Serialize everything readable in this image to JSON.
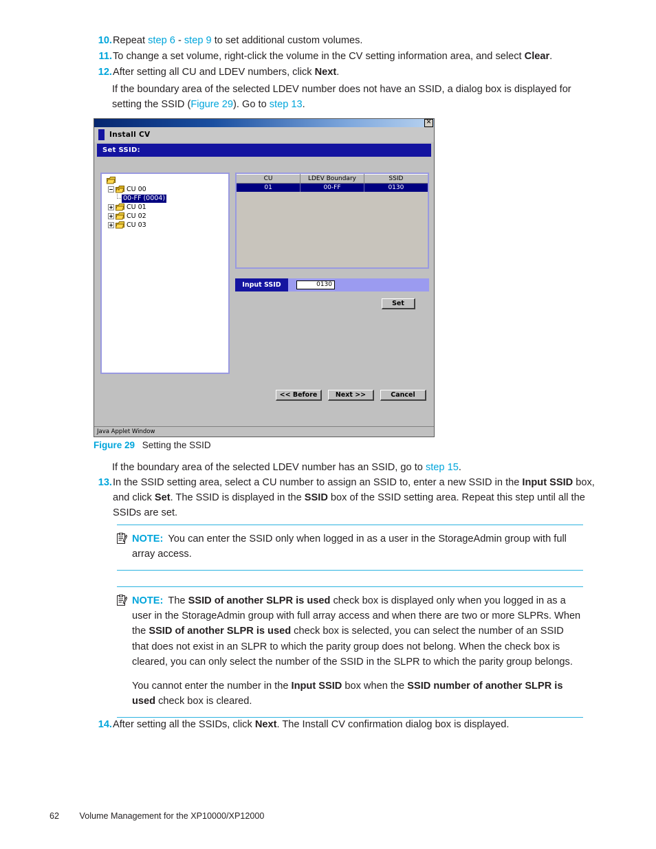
{
  "steps_top": [
    {
      "num": "10.",
      "parts": [
        {
          "t": "Repeat ",
          "s": "n"
        },
        {
          "t": "step 6",
          "s": "l"
        },
        {
          "t": " - ",
          "s": "n"
        },
        {
          "t": "step 9",
          "s": "l"
        },
        {
          "t": " to set additional custom volumes.",
          "s": "n"
        }
      ]
    },
    {
      "num": "11.",
      "parts": [
        {
          "t": "To change a set volume, right-click the volume in the CV setting information area, and select ",
          "s": "n"
        },
        {
          "t": "Clear",
          "s": "b"
        },
        {
          "t": ".",
          "s": "n"
        }
      ]
    },
    {
      "num": "12.",
      "parts": [
        {
          "t": "After setting all CU and LDEV numbers, click ",
          "s": "n"
        },
        {
          "t": "Next",
          "s": "b"
        },
        {
          "t": ".",
          "s": "n"
        }
      ]
    }
  ],
  "sub_para_12": [
    {
      "t": "If the boundary area of the selected LDEV number does not have an SSID, a dialog box is displayed for setting the SSID (",
      "s": "n"
    },
    {
      "t": "Figure 29",
      "s": "l"
    },
    {
      "t": "). Go to ",
      "s": "n"
    },
    {
      "t": "step 13",
      "s": "l"
    },
    {
      "t": ".",
      "s": "n"
    }
  ],
  "dialog": {
    "title": "Install CV",
    "close_icon": "close-icon",
    "section_label": "Set SSID:",
    "tree": {
      "root_icon": "root-folder-icon",
      "nodes": [
        {
          "label": "CU 00",
          "toggle": "minus",
          "indent": 1,
          "selected": false,
          "icon": "folder-open-icon"
        },
        {
          "label": "00-FF (0004)",
          "toggle": "none",
          "indent": 2,
          "selected": true,
          "icon": "none"
        },
        {
          "label": "CU 01",
          "toggle": "plus",
          "indent": 1,
          "selected": false,
          "icon": "folder-icon"
        },
        {
          "label": "CU 02",
          "toggle": "plus",
          "indent": 1,
          "selected": false,
          "icon": "folder-icon"
        },
        {
          "label": "CU 03",
          "toggle": "plus",
          "indent": 1,
          "selected": false,
          "icon": "folder-icon"
        }
      ]
    },
    "table": {
      "columns": [
        "CU",
        "LDEV Boundary",
        "SSID"
      ],
      "rows": [
        [
          "01",
          "00-FF",
          "0130"
        ]
      ]
    },
    "input_ssid": {
      "label": "Input SSID",
      "value": "0130"
    },
    "set_button": "Set",
    "footer_buttons": [
      "<< Before",
      "Next >>",
      "Cancel"
    ],
    "status_bar": "Java Applet Window"
  },
  "figure_caption": {
    "label": "Figure 29",
    "text": "Setting the SSID"
  },
  "para_after_figure": [
    {
      "t": "If the boundary area of the selected LDEV number has an SSID, go to ",
      "s": "n"
    },
    {
      "t": "step 15",
      "s": "l"
    },
    {
      "t": ".",
      "s": "n"
    }
  ],
  "step13": {
    "num": "13.",
    "parts": [
      {
        "t": "In the SSID setting area, select a CU number to assign an SSID to, enter a new SSID in the ",
        "s": "n"
      },
      {
        "t": "Input SSID",
        "s": "b"
      },
      {
        "t": " box, and click ",
        "s": "n"
      },
      {
        "t": "Set",
        "s": "b"
      },
      {
        "t": ". The SSID is displayed in the ",
        "s": "n"
      },
      {
        "t": "SSID",
        "s": "b"
      },
      {
        "t": " box of the SSID setting area. Repeat this step until all the SSIDs are set.",
        "s": "n"
      }
    ]
  },
  "note1": {
    "icon": "note-clipboard-icon",
    "word": "NOTE:",
    "parts": [
      {
        "t": "You can enter the SSID only when logged in as a user in the StorageAdmin group with full array access.",
        "s": "n"
      }
    ]
  },
  "note2": {
    "icon": "note-clipboard-icon",
    "word": "NOTE:",
    "parts": [
      {
        "t": "The ",
        "s": "n"
      },
      {
        "t": "SSID of another SLPR is used",
        "s": "b"
      },
      {
        "t": " check box is displayed only when you logged in as a user in the StorageAdmin group with full array access and when there are two or more SLPRs. When the ",
        "s": "n"
      },
      {
        "t": "SSID of another SLPR is used",
        "s": "b"
      },
      {
        "t": " check box is selected, you can select the number of an SSID that does not exist in an SLPR to which the parity group does not belong. When the check box is cleared, you can only select the number of the SSID in the SLPR to which the parity group belongs.",
        "s": "n"
      }
    ],
    "parts2": [
      {
        "t": "You cannot enter the number in the ",
        "s": "n"
      },
      {
        "t": "Input SSID",
        "s": "b"
      },
      {
        "t": " box when the ",
        "s": "n"
      },
      {
        "t": "SSID number of another SLPR is used",
        "s": "b"
      },
      {
        "t": " check box is cleared.",
        "s": "n"
      }
    ]
  },
  "step14": {
    "num": "14.",
    "parts": [
      {
        "t": "After setting all the SSIDs, click ",
        "s": "n"
      },
      {
        "t": "Next",
        "s": "b"
      },
      {
        "t": ". The Install CV confirmation dialog box is displayed.",
        "s": "n"
      }
    ]
  },
  "footer": {
    "page_number": "62",
    "title": "Volume Management for the XP10000/XP12000"
  },
  "colors": {
    "accent": "#00a5db",
    "note_rule": "#2bb3e0",
    "dialog_blue": "#1414a0",
    "selection": "#000080"
  }
}
